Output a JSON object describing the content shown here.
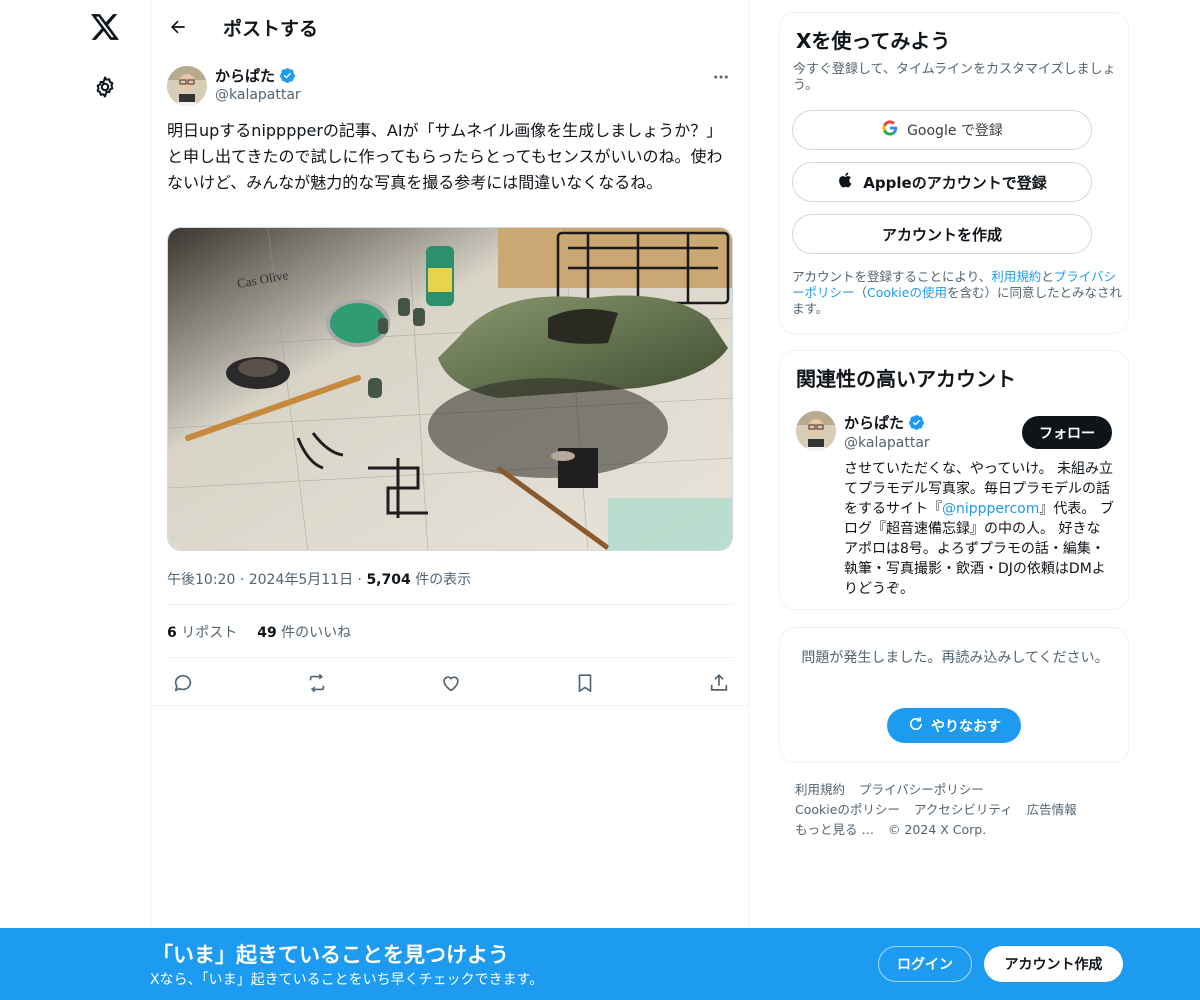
{
  "nav": {
    "logo_icon": "x-logo-icon",
    "settings_icon": "gear-icon"
  },
  "header": {
    "title": "ポストする",
    "back_icon": "arrow-left-icon"
  },
  "post": {
    "author_name": "からぱた",
    "author_handle": "@kalapattar",
    "text": "明日upするnipppperの記事、AIが「サムネイル画像を生成しましょうか？」と申し出てきたので試しに作ってもらったらとってもセンスがいいのね。使わないけど、みんなが魅力的な写真を撮る参考には間違いなくなるね。",
    "time": "午後10:20",
    "date": "2024年5月11日",
    "views_count": "5,704",
    "views_label": "件の表示",
    "reposts_count": "6",
    "reposts_label": "リポスト",
    "likes_count": "49",
    "likes_label": "件のいいね",
    "image_label": "Cas Olive"
  },
  "signup": {
    "title": "Xを使ってみよう",
    "subtitle": "今すぐ登録して、タイムラインをカスタマイズしましょう。",
    "google_label": "Google で登録",
    "apple_label": "Appleのアカウントで登録",
    "create_label": "アカウントを作成",
    "legal_1": "アカウントを登録することにより、",
    "legal_terms": "利用規約",
    "legal_2": "と",
    "legal_privacy": "プライバシーポリシー",
    "legal_3": "（",
    "legal_cookie": "Cookieの使用",
    "legal_4": "を含む）に同意したとみなされます。"
  },
  "related": {
    "title": "関連性の高いアカウント",
    "name": "からぱた",
    "handle": "@kalapattar",
    "follow_label": "フォロー",
    "bio_1": "させていただくな、やっていけ。 未組み立てプラモデル写真家。毎日プラモデルの話をするサイト『",
    "bio_link": "@nipppercom",
    "bio_2": "』代表。 ブログ『超音速備忘録』の中の人。 好きなアポロは8号。よろずプラモの話・編集・執筆・写真撮影・飲酒・DJの依頼はDMよりどうぞ。"
  },
  "error": {
    "message": "問題が発生しました。再読み込みしてください。",
    "retry_label": "やりなおす"
  },
  "footer": {
    "terms": "利用規約",
    "privacy": "プライバシーポリシー",
    "cookie": "Cookieのポリシー",
    "accessibility": "アクセシビリティ",
    "ads": "広告情報",
    "more": "もっと見る …",
    "copyright": "© 2024 X Corp."
  },
  "banner": {
    "title": "「いま」起きていることを見つけよう",
    "subtitle": "Xなら、「いま」起きていることをいち早くチェックできます。",
    "login_label": "ログイン",
    "create_label": "アカウント作成"
  },
  "colors": {
    "accent": "#1d9bf0",
    "text": "#0f1419",
    "muted": "#536471",
    "border": "#eff3f4"
  }
}
